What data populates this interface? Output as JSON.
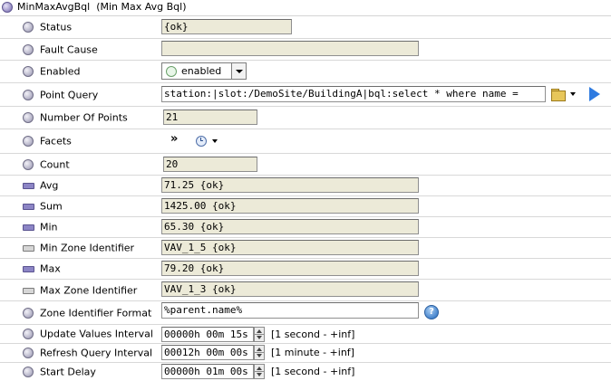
{
  "header": {
    "title": "MinMaxAvgBql",
    "subtitle": "(Min Max Avg Bql)"
  },
  "rows": {
    "status": {
      "label": "Status",
      "value": "{ok}"
    },
    "fault_cause": {
      "label": "Fault Cause",
      "value": ""
    },
    "enabled": {
      "label": "Enabled",
      "value": "enabled"
    },
    "point_query": {
      "label": "Point Query",
      "value": "station:|slot:/DemoSite/BuildingA|bql:select * where name ="
    },
    "number_of_points": {
      "label": "Number Of Points",
      "value": "21"
    },
    "facets": {
      "label": "Facets",
      "value": "»"
    },
    "count": {
      "label": "Count",
      "value": "20"
    },
    "avg": {
      "label": "Avg",
      "value": "71.25 {ok}"
    },
    "sum": {
      "label": "Sum",
      "value": "1425.00 {ok}"
    },
    "min": {
      "label": "Min",
      "value": "65.30 {ok}"
    },
    "min_zone_identifier": {
      "label": "Min Zone Identifier",
      "value": "VAV_1_5 {ok}"
    },
    "max": {
      "label": "Max",
      "value": "79.20 {ok}"
    },
    "max_zone_identifier": {
      "label": "Max Zone Identifier",
      "value": "VAV_1_3 {ok}"
    },
    "zone_identifier_format": {
      "label": "Zone Identifier Format",
      "value": "%parent.name%",
      "help": "?"
    },
    "update_values_interval": {
      "label": "Update Values Interval",
      "value": "00000h 00m 15s",
      "range": "[1 second - +inf]"
    },
    "refresh_query_interval": {
      "label": "Refresh Query Interval",
      "value": "00012h 00m 00s",
      "range": "[1 minute - +inf]"
    },
    "start_delay": {
      "label": "Start Delay",
      "value": "00000h 01m 00s",
      "range": "[1 second - +inf]"
    }
  },
  "icons": {
    "property": "circle-icon",
    "numeric": "bar-icon",
    "string": "bar-icon",
    "folder": "folder-icon",
    "play": "play-icon",
    "help": "help-icon",
    "clock": "clock-icon"
  },
  "colors": {
    "field_bg": "#ecead8",
    "play": "#2f7be0",
    "header_dot": "#8f85c0"
  }
}
